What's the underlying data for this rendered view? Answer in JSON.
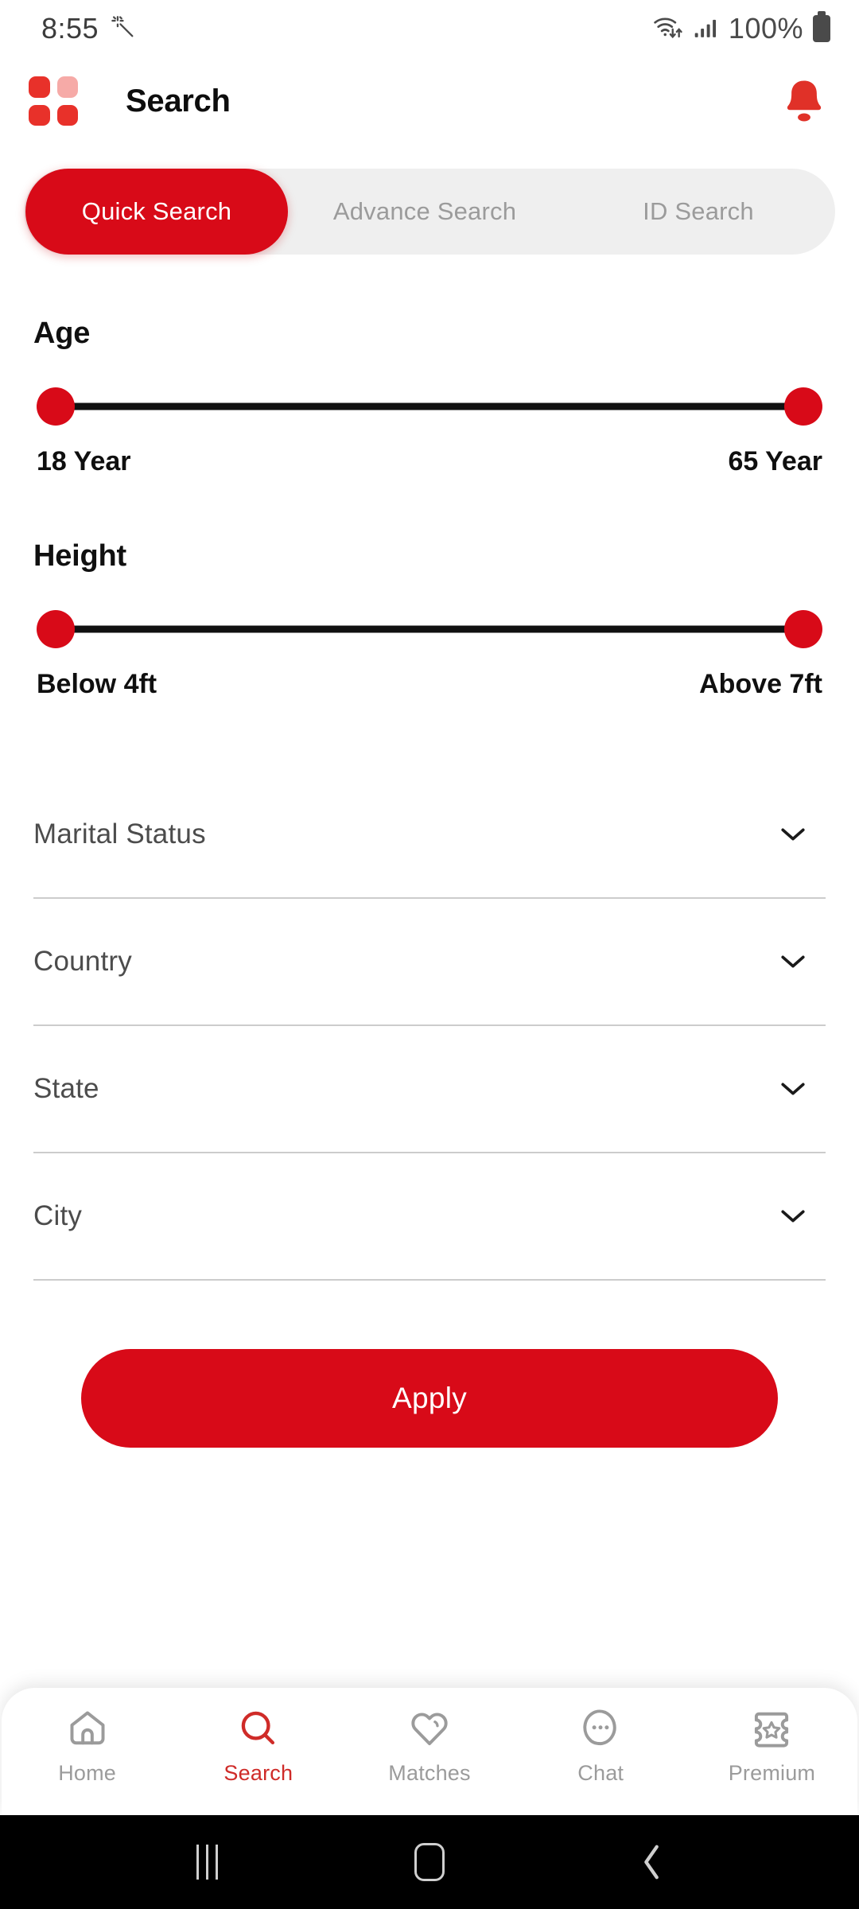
{
  "status_bar": {
    "clock": "8:55",
    "battery_percent": "100%",
    "icons": [
      "magic-wand-icon",
      "wifi-icon",
      "cellular-signal-icon",
      "battery-icon"
    ]
  },
  "header": {
    "title": "Search",
    "logo_icon": "grid-logo-icon",
    "notification_icon": "bell-icon"
  },
  "tabs": [
    {
      "label": "Quick Search",
      "active": true
    },
    {
      "label": "Advance Search",
      "active": false
    },
    {
      "label": "ID Search",
      "active": false
    }
  ],
  "filters": {
    "age": {
      "title": "Age",
      "min_label": "18 Year",
      "max_label": "65 Year",
      "min_value": 18,
      "max_value": 65
    },
    "height": {
      "title": "Height",
      "min_label": "Below 4ft",
      "max_label": "Above 7ft",
      "min_value": 4,
      "max_value": 7
    },
    "dropdowns": [
      {
        "label": "Marital Status",
        "value": "",
        "icon": "chevron-down-icon"
      },
      {
        "label": "Country",
        "value": "",
        "icon": "chevron-down-icon"
      },
      {
        "label": "State",
        "value": "",
        "icon": "chevron-down-icon"
      },
      {
        "label": "City",
        "value": "",
        "icon": "chevron-down-icon"
      }
    ]
  },
  "apply_button": {
    "label": "Apply"
  },
  "bottom_nav": [
    {
      "label": "Home",
      "icon": "home-icon",
      "active": false
    },
    {
      "label": "Search",
      "icon": "search-icon",
      "active": true
    },
    {
      "label": "Matches",
      "icon": "heart-icon",
      "active": false
    },
    {
      "label": "Chat",
      "icon": "chat-bubble-icon",
      "active": false
    },
    {
      "label": "Premium",
      "icon": "ticket-star-icon",
      "active": false
    }
  ],
  "system_nav": [
    {
      "icon": "recents-icon"
    },
    {
      "icon": "home-square-icon"
    },
    {
      "icon": "back-chevron-icon"
    }
  ],
  "colors": {
    "brand_red": "#d80a18",
    "logo_red": "#e8312a",
    "logo_pale": "#f6aaa7",
    "tab_track": "#efefef",
    "inactive_text": "#9b9b9b",
    "track_black": "#111111"
  }
}
